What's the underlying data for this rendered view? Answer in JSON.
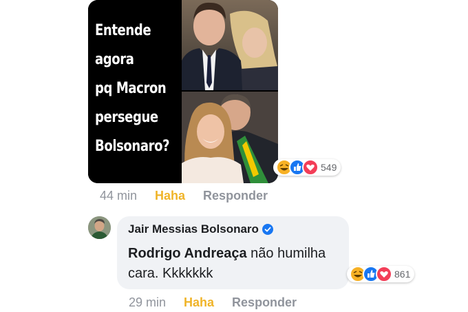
{
  "post": {
    "meme_lines": [
      "Entende",
      "agora",
      "pq Macron",
      "persegue",
      "Bolsonaro?"
    ],
    "reactions": {
      "icons": [
        "haha-icon",
        "like-icon",
        "love-icon"
      ],
      "count": "549"
    },
    "meta": {
      "time": "44 min",
      "reaction": "Haha",
      "reply": "Responder"
    }
  },
  "reply_comment": {
    "author": "Jair Messias Bolsonaro",
    "mention": "Rodrigo Andreaça",
    "text": " não humilha cara. Kkkkkkk",
    "reactions": {
      "icons": [
        "haha-icon",
        "like-icon",
        "love-icon"
      ],
      "count": "861"
    },
    "meta": {
      "time": "29 min",
      "reaction": "Haha",
      "reply": "Responder"
    }
  },
  "colors": {
    "haha_link": "#f0b429",
    "meta_gray": "#90949c",
    "bubble_bg": "#f0f2f5",
    "like_blue": "#1877f2",
    "love_red": "#f33e58",
    "haha_yellow": "#f7b125"
  }
}
